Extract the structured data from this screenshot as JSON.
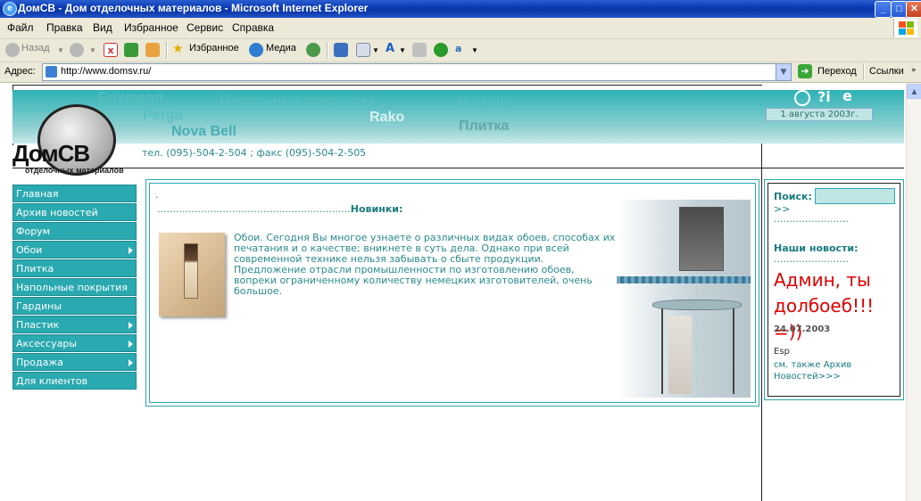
{
  "window": {
    "title": "ДомСВ - Дом отделочных материалов - Microsoft Internet Explorer",
    "buttons": {
      "minimize": "_",
      "maximize": "□",
      "close": "✕"
    }
  },
  "menubar": {
    "items": [
      "Файл",
      "Правка",
      "Вид",
      "Избранное",
      "Сервис",
      "Справка"
    ]
  },
  "toolbar": {
    "back": "Назад",
    "favorites": "Избранное",
    "media": "Медиа"
  },
  "address": {
    "label": "Адрес:",
    "url": "http://www.domsv.ru/",
    "go": "Переход",
    "links": "Ссылки"
  },
  "site": {
    "banner_words": [
      "Обои",
      "Erismann",
      "Напольные покрытия",
      "Perga",
      "Nova Bell",
      "Rako",
      "Marburg",
      "Плитка"
    ],
    "logo": {
      "text": "ДомСВ",
      "sub": "отделочных материалов"
    },
    "phones": "тел. (095)-504-2-504 ; факс (095)-504-2-505",
    "date": "1 августа 2003г.",
    "nav": [
      {
        "label": "Главная",
        "has_submenu": false
      },
      {
        "label": "Архив новостей",
        "has_submenu": false
      },
      {
        "label": "Форум",
        "has_submenu": false
      },
      {
        "label": "Обои",
        "has_submenu": true
      },
      {
        "label": "Плитка",
        "has_submenu": false
      },
      {
        "label": "Напольные покрытия",
        "has_submenu": false
      },
      {
        "label": "Гардины",
        "has_submenu": false
      },
      {
        "label": "Пластик",
        "has_submenu": true
      },
      {
        "label": "Аксессуары",
        "has_submenu": true
      },
      {
        "label": "Продажа",
        "has_submenu": true
      },
      {
        "label": "Для клиентов",
        "has_submenu": false
      }
    ],
    "main": {
      "top_dot": ".",
      "dots": "..............................................................",
      "new_label": "Новинки:",
      "intro": "Обои. Сегодня Вы многое узнаете о различных видах обоев, способах их печатания и о качестве; вникнете в суть дела. Однако при всей современной технике нельзя забывать о сбыте продукции. Предложение отрасли промышленности по изготовлению обоев, вопреки ограниченному количеству немецких изготовителей, очень большое."
    },
    "right": {
      "search_label": "Поиск:",
      "search_value": "",
      "search_go": ">>",
      "dots1": "........................",
      "news_label": "Наши новости:",
      "dots2": "........................",
      "news_text": "Админ, ты долбоеб!!! =))",
      "news_date": "24.07.2003",
      "esp": "Esp",
      "archive": "см. также Архив Новостей>>>"
    },
    "colors": {
      "accent": "#2aa9b0",
      "text": "#2a8a8c",
      "news": "#e00000"
    }
  }
}
